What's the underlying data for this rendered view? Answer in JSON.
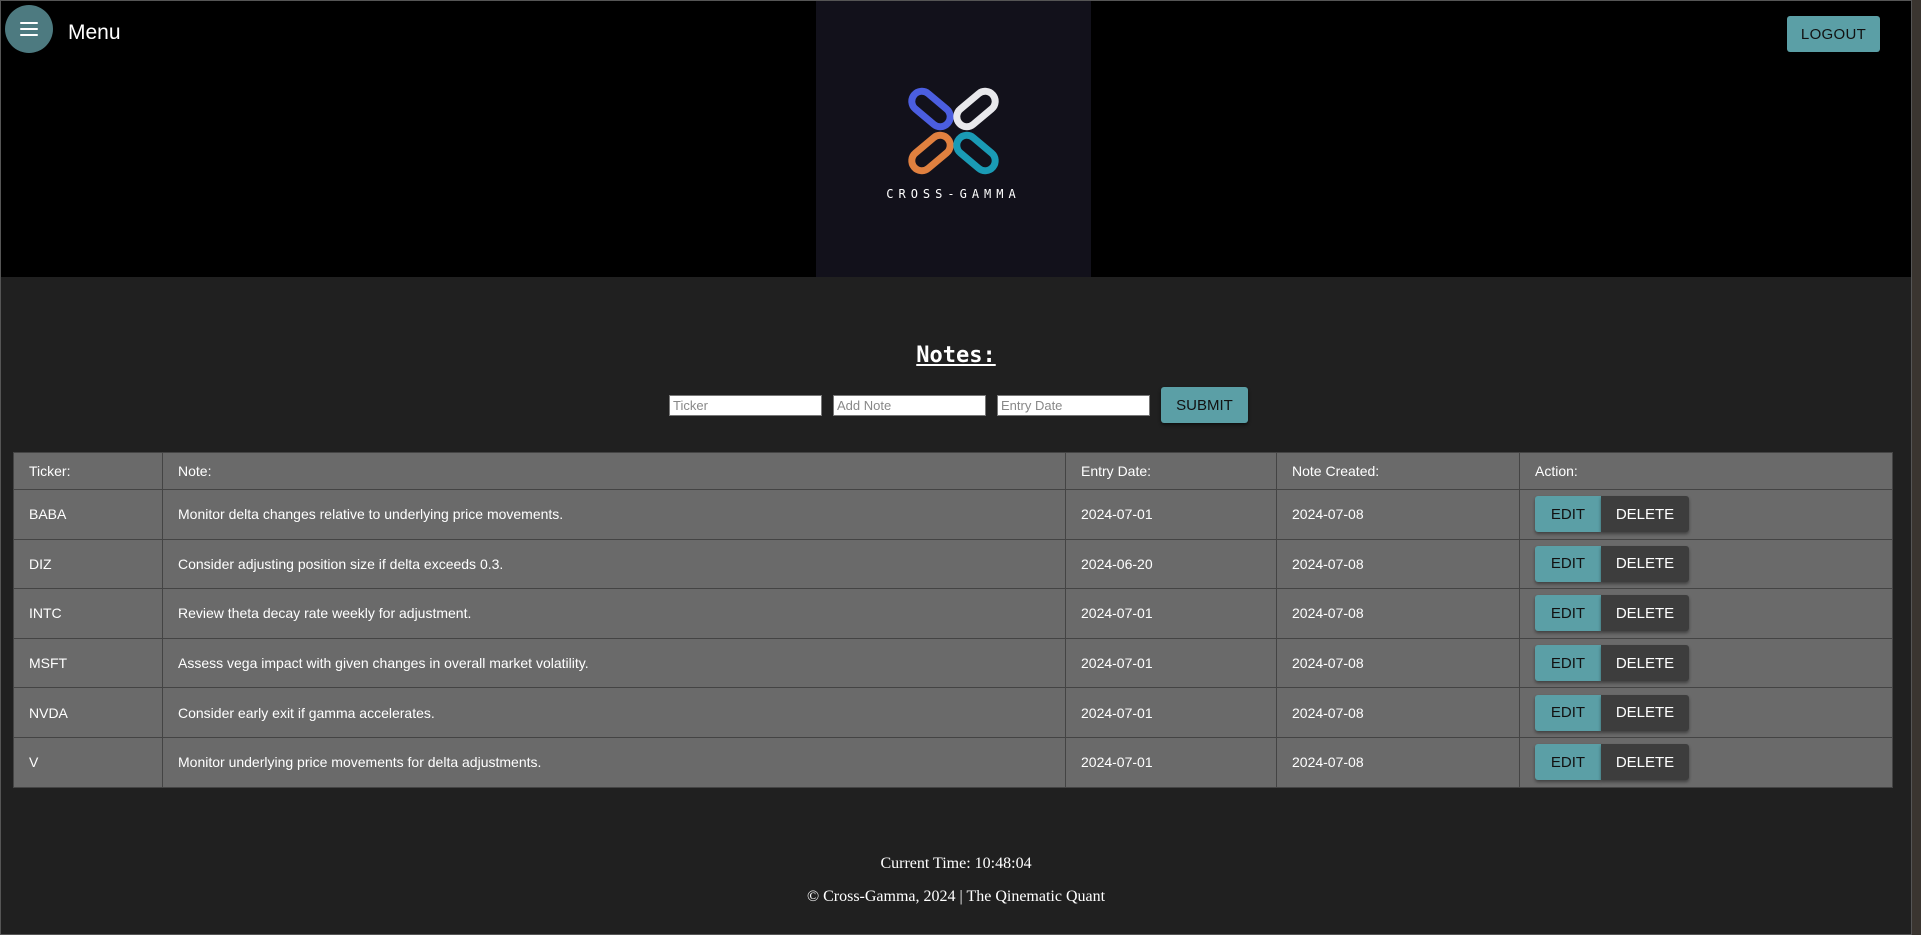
{
  "header": {
    "menu_label": "Menu",
    "logo_text": "CROSS-GAMMA",
    "logout_label": "LOGOUT",
    "logo_colors": [
      "#4b5ee0",
      "#e8e8ec",
      "#e0803f",
      "#1a9bb5"
    ]
  },
  "notes": {
    "title": "Notes:",
    "form": {
      "ticker_placeholder": "Ticker",
      "note_placeholder": "Add Note",
      "date_placeholder": "Entry Date",
      "submit_label": "SUBMIT"
    },
    "table": {
      "headers": [
        "Ticker:",
        "Note:",
        "Entry Date:",
        "Note Created:",
        "Action:"
      ],
      "edit_label": "EDIT",
      "delete_label": "DELETE",
      "rows": [
        {
          "ticker": "BABA",
          "note": "Monitor delta changes relative to underlying price movements.",
          "entry_date": "2024-07-01",
          "created": "2024-07-08"
        },
        {
          "ticker": "DIZ",
          "note": "Consider adjusting position size if delta exceeds 0.3.",
          "entry_date": "2024-06-20",
          "created": "2024-07-08"
        },
        {
          "ticker": "INTC",
          "note": "Review theta decay rate weekly for adjustment.",
          "entry_date": "2024-07-01",
          "created": "2024-07-08"
        },
        {
          "ticker": "MSFT",
          "note": "Assess vega impact with given changes in overall market volatility.",
          "entry_date": "2024-07-01",
          "created": "2024-07-08"
        },
        {
          "ticker": "NVDA",
          "note": "Consider early exit if gamma accelerates.",
          "entry_date": "2024-07-01",
          "created": "2024-07-08"
        },
        {
          "ticker": "V",
          "note": "Monitor underlying price movements for delta adjustments.",
          "entry_date": "2024-07-01",
          "created": "2024-07-08"
        }
      ]
    }
  },
  "footer": {
    "current_time": "Current Time: 10:48:04",
    "copyright": "© Cross-Gamma, 2024 | The Qinematic Quant"
  },
  "colors": {
    "accent": "#5b9fa6",
    "background": "#202020",
    "table_bg": "#6a6a6a",
    "delete_bg": "#3d3d3d"
  }
}
